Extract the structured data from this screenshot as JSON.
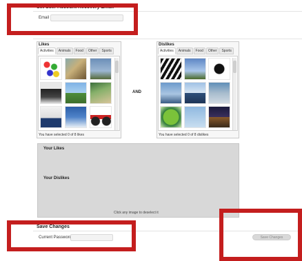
{
  "recovery": {
    "title": "Set User Account Recovery Email",
    "email_label": "Email",
    "email_value": "",
    "email_placeholder": ""
  },
  "likes": {
    "title": "Likes",
    "tabs": [
      "Activities",
      "Animals",
      "Food",
      "Other",
      "Sports"
    ],
    "active_tab": "Activities",
    "status": "You have selected 0 of 8 likes",
    "images": [
      "flower-balls",
      "dog",
      "plane",
      "chess",
      "field",
      "hand",
      "sailor",
      "snow",
      "motorcycle"
    ]
  },
  "and_label": "AND",
  "dislikes": {
    "title": "Dislikes",
    "tabs": [
      "Activities",
      "Animals",
      "Food",
      "Other",
      "Sports"
    ],
    "active_tab": "Activities",
    "status": "You have selected 0 of 8 dislikes",
    "images": [
      "piano",
      "sky",
      "gymnast",
      "hand",
      "boat",
      "sail",
      "ball",
      "bird",
      "tent"
    ]
  },
  "summary": {
    "likes_heading": "Your Likes",
    "dislikes_heading": "Your Dislikes",
    "hint": "Click any image to deselect it"
  },
  "save": {
    "title": "Save Changes",
    "password_label": "Current Password",
    "password_value": "",
    "button_label": "Save Changes"
  },
  "colors": {
    "highlight": "#c41e1e",
    "summary_bg": "#d8d8d8"
  }
}
